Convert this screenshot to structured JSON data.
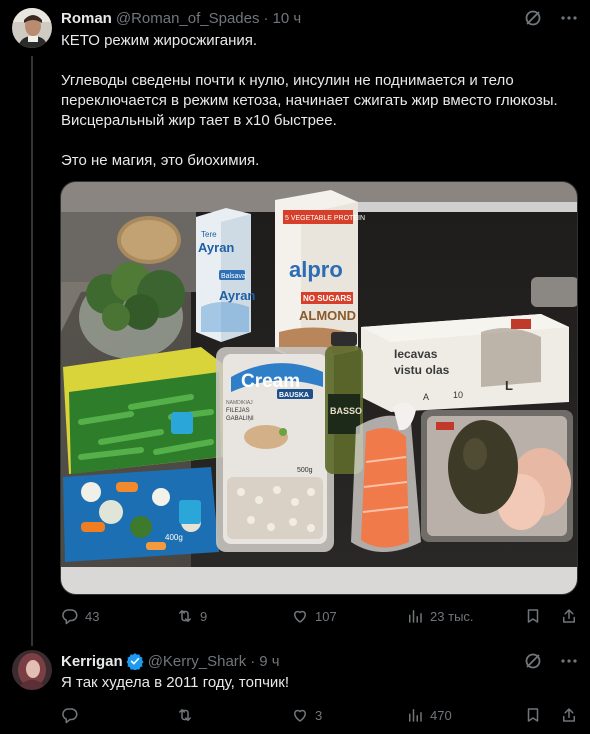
{
  "tweet1": {
    "name": "Roman",
    "handle": "@Roman_of_Spades",
    "dot": "·",
    "time": "10 ч",
    "lines": [
      "КЕТО режим жиросжигания.",
      "",
      "Углеводы сведены почти к нулю, инсулин не поднимается и тело",
      "переключается в режим кетоза, начинает сжигать жир вместо глюкозы.",
      "Висцеральный жир тает в х10 быстрее.",
      "",
      "Это не магия, это биохимия."
    ],
    "photo_labels": {
      "ayran_brand": "Tere",
      "ayran1": "Ayran",
      "ayran_sub": "Balsava",
      "ayran2": "Ayran",
      "alpro_top": "5 VEGETABLE PROTEIN",
      "alpro": "alpro",
      "no_sugars": "NO SUGARS",
      "almond": "ALMOND",
      "eggs1": "Iecavas",
      "eggs2": "vistu olas",
      "eggs_grade": "A",
      "eggs_count": "10",
      "eggs_size": "L",
      "cream": "Cream",
      "bauska": "BAUSKA",
      "cream_sub1": "NAMDIKIAJ",
      "cream_sub2": "FILEJAS",
      "cream_sub3": "GABALIŅI",
      "cream_weight": "500g",
      "basso": "BASSO",
      "frozen_weight": "400g"
    },
    "replies": "43",
    "retweets": "9",
    "likes": "107",
    "views": "23 тыс."
  },
  "tweet2": {
    "name": "Kerrigan",
    "handle": "@Kerry_Shark",
    "dot": "·",
    "time": "9 ч",
    "text": "Я так худела в 2011 году, топчик!",
    "replies": "",
    "retweets": "",
    "likes": "3",
    "views": "470"
  },
  "colors": {
    "background": "#000000",
    "text": "#e7e9ea",
    "muted": "#71767b",
    "verified": "#1d9bf0",
    "divider": "#2f3336"
  },
  "icons": [
    "grok-icon",
    "more-icon",
    "reply-icon",
    "retweet-icon",
    "like-icon",
    "views-icon",
    "bookmark-icon",
    "share-icon",
    "verified-icon"
  ]
}
